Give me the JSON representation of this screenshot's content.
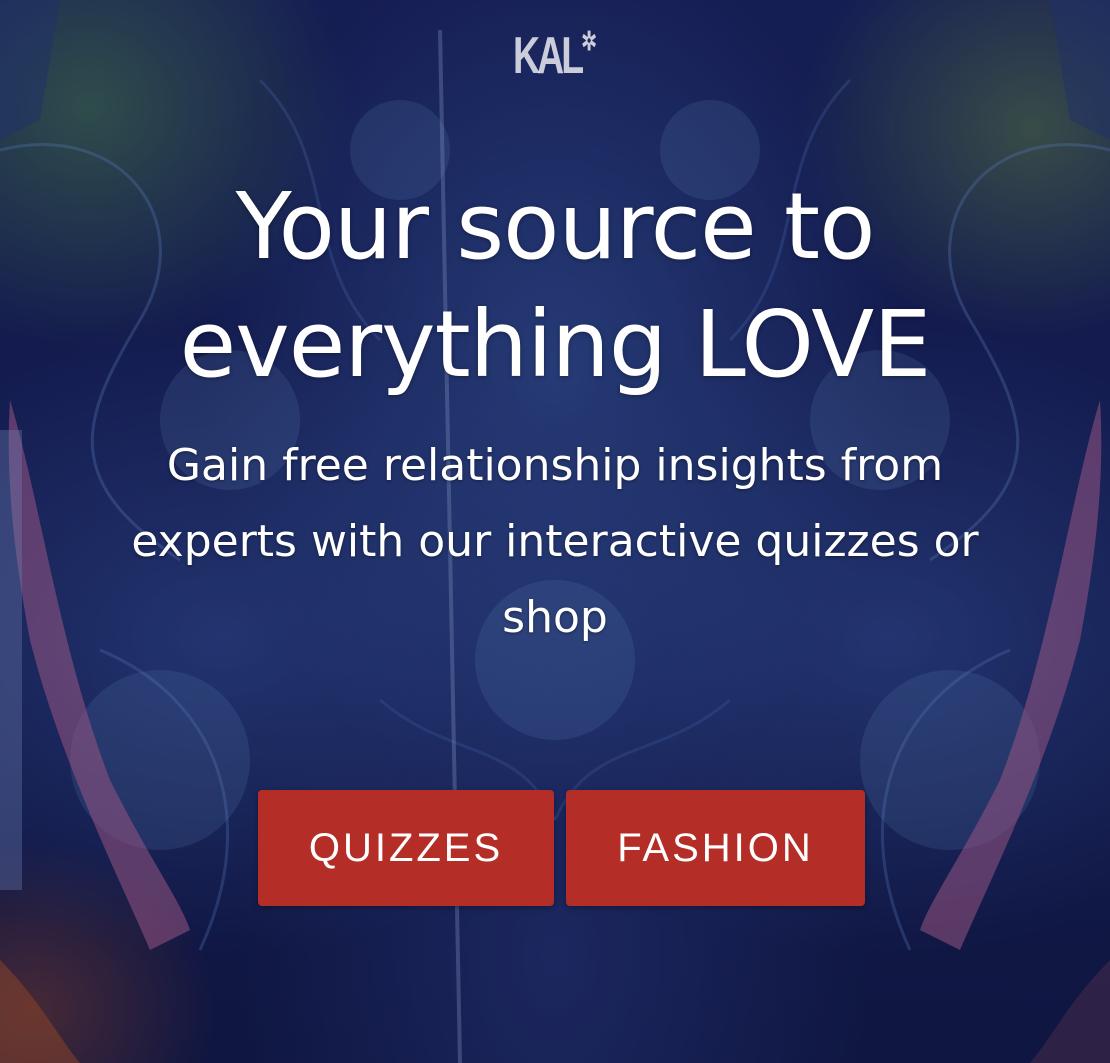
{
  "brand": {
    "logo_text": "KAL",
    "logo_mark": "✲"
  },
  "hero": {
    "headline": "Your source to everything LOVE",
    "subheadline": "Gain free relationship insights from experts with our interactive quizzes or shop",
    "background_icon": "ornate-dragon-artwork"
  },
  "buttons": {
    "quizzes_label": "QUIZZES",
    "fashion_label": "FASHION"
  },
  "colors": {
    "button_bg": "#b42e27",
    "text": "#ffffff",
    "background": "#17205a"
  }
}
